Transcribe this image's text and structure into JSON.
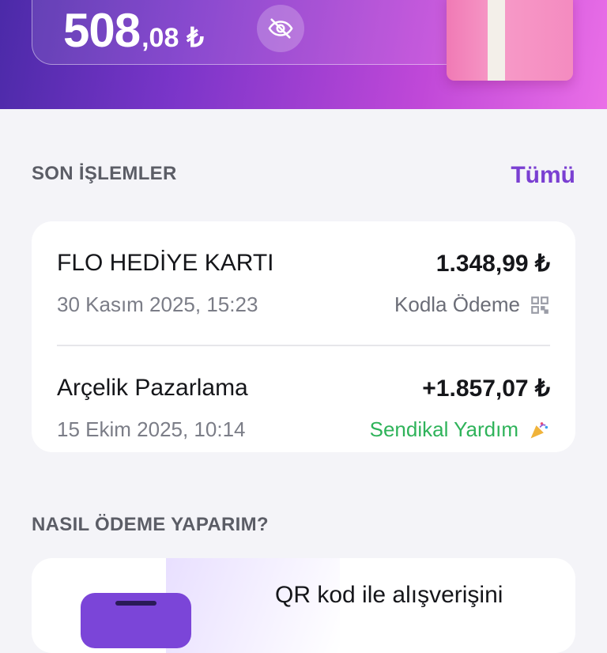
{
  "header": {
    "balance_int": "508",
    "balance_dec": ",08",
    "currency": "₺",
    "visibility_icon": "eye-off-icon",
    "gift_icon": "gift-box"
  },
  "recent": {
    "title": "SON İŞLEMLER",
    "see_all": "Tümü",
    "transactions": [
      {
        "name": "FLO HEDİYE KARTI",
        "date": "30 Kasım 2025, 15:23",
        "amount": "1.348,99 ₺",
        "type": "Kodla Ödeme",
        "type_icon": "qr-code-icon",
        "type_color": "#6b6d77"
      },
      {
        "name": "Arçelik Pazarlama",
        "date": "15 Ekim 2025, 10:14",
        "amount": "+1.857,07 ₺",
        "type": "Sendikal Yardım",
        "type_icon": "party-popper-icon",
        "type_color": "#2fb35a"
      }
    ]
  },
  "howto": {
    "title": "NASIL ÖDEME YAPARIM?",
    "promo_text": "QR kod ile alışverişini"
  },
  "colors": {
    "accent": "#7a3fd2",
    "positive": "#2fb35a"
  }
}
